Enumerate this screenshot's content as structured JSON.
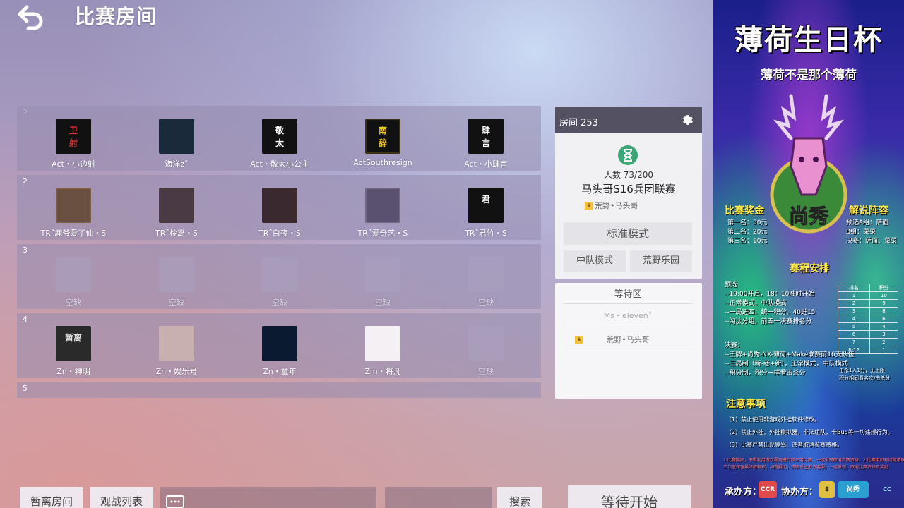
{
  "header": {
    "title": "比赛房间"
  },
  "groups": [
    {
      "number": "1",
      "slots": [
        {
          "name": "Act・小边射",
          "avatar": "卫\n射",
          "bg": "#111111",
          "accent": "#d33"
        },
        {
          "name": "海洋z˚",
          "avatar": "",
          "bg": "#1b2a3a",
          "accent": "#5ab"
        },
        {
          "name": "Act・敬太小公主",
          "avatar": "敬\n太",
          "bg": "#111111",
          "accent": "#fff"
        },
        {
          "name": "ActSouthresign",
          "avatar": "南\n辞",
          "bg": "#111111",
          "accent": "#e8c020"
        },
        {
          "name": "Act・小肆言",
          "avatar": "肆\n言",
          "bg": "#111111",
          "accent": "#fff"
        }
      ]
    },
    {
      "number": "2",
      "slots": [
        {
          "name": "TR˚鹿爷爱了仙・S",
          "avatar": "",
          "bg": "#6a5040",
          "accent": "#c8a070"
        },
        {
          "name": "TR˚柃离・S",
          "avatar": "",
          "bg": "#4a3a44",
          "accent": "#c88"
        },
        {
          "name": "TR˚白夜・S",
          "avatar": "",
          "bg": "#3a2a30",
          "accent": "#b99"
        },
        {
          "name": "TR˚爱奇艺・S",
          "avatar": "",
          "bg": "#5a5070",
          "accent": "#d8c0d0"
        },
        {
          "name": "TR˚君竹・S",
          "avatar": "君",
          "bg": "#111111",
          "accent": "#fff"
        }
      ]
    },
    {
      "number": "3",
      "slots": [
        {
          "name": "空缺",
          "empty": true
        },
        {
          "name": "空缺",
          "empty": true
        },
        {
          "name": "空缺",
          "empty": true
        },
        {
          "name": "空缺",
          "empty": true
        },
        {
          "name": "空缺",
          "empty": true
        }
      ]
    },
    {
      "number": "4",
      "slots": [
        {
          "name": "Zn・神明",
          "avatar": "暂离",
          "bg": "#2a2a2a",
          "accent": "#ddd"
        },
        {
          "name": "Zn・娱乐号",
          "avatar": "",
          "bg": "#c8b0b0",
          "accent": "#433"
        },
        {
          "name": "Zn・童年",
          "avatar": "",
          "bg": "#0a1a30",
          "accent": "#6cf"
        },
        {
          "name": "Zm・将凡",
          "avatar": "",
          "bg": "#f4f0f4",
          "accent": "#aaa"
        },
        {
          "name": "空缺",
          "empty": true
        }
      ]
    },
    {
      "number": "5",
      "slots": []
    }
  ],
  "room": {
    "header": "房间 253",
    "player_count": "人数 73/200",
    "name": "马头哥S16兵团联赛",
    "owner": "荒野•马头哥",
    "mode_button": "标准模式",
    "tab_squad": "中队模式",
    "tab_wild": "荒野乐园"
  },
  "waiting": {
    "title": "等待区",
    "players": [
      "Ms・eleven˚",
      "荒野•马头哥"
    ]
  },
  "bottom": {
    "leave": "暂离房间",
    "watch_list": "观战列表",
    "search": "搜索",
    "start": "等待开始"
  },
  "poster": {
    "title": "薄荷生日杯",
    "subtitle": "薄荷不是那个薄荷",
    "logo_text": "尚秀",
    "prize_head": "比赛奖金",
    "prize_lines": "第一名：30元\n第二名：20元\n第三名：10元",
    "caster_head": "解说阵容",
    "caster_lines": "预选A组：萨面\nB组：菜菜\n决赛：萨面、菜菜",
    "schedule_head": "赛程安排",
    "group_stage": "预选\n--19:00开启，18：10准时开始\n--正常模式，中队模式\n--一局进四，统一积分，40进15\n--淘汰分组，前五一决赛排名分",
    "finals": "决赛：\n--王牌+尚秀-NX-薄荷+Make联赛前16支队伍\n--三局制（新-老+新），正常模式，中队模式\n--积分制，积分一样看击杀分",
    "rank_rows": [
      [
        "排名",
        "积分"
      ],
      [
        "1",
        "10"
      ],
      [
        "2",
        "9"
      ],
      [
        "3",
        "8"
      ],
      [
        "4",
        "6"
      ],
      [
        "5",
        "4"
      ],
      [
        "6",
        "3"
      ],
      [
        "7",
        "2"
      ],
      [
        "8-12",
        "1"
      ]
    ],
    "rank_note": "击杀1人1分，无上限\n积分相同看名次/击杀分",
    "notice_head": "注意事项",
    "notice_lines": "（1）禁止使用非游戏外挂软件修改。\n（2）禁止外挂，外挂模拟器，非法组队，卡Bug等一切违规行为。\n（3）比赛严禁出现辱骂、违者取消参赛资格。",
    "fine_print": "1.比赛期间，不得利用游戏漏洞进行非正常比赛，一经发现取消参赛资格，2.比赛中如有问题请联系管理员\n工作室保留最终解释权，如有疑问，请联系主办方客服，一经发现，取消比赛资格及奖励",
    "organizer": "承办方：",
    "co_organizer": "协办方："
  },
  "colors": {
    "accent_yellow": "#ffe94a",
    "panel_dark": "#545262"
  }
}
